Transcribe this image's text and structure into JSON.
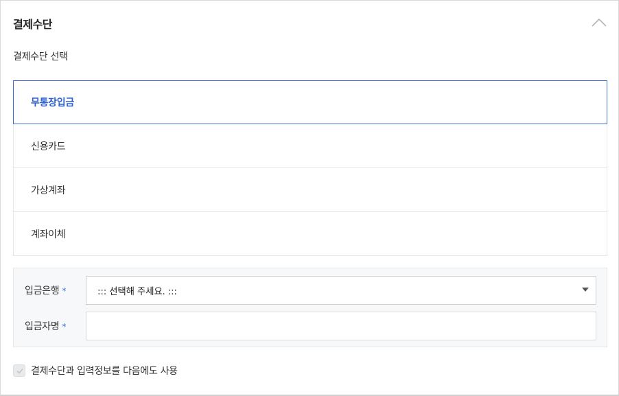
{
  "section": {
    "title": "결제수단",
    "collapse_icon": "chevron-up-icon",
    "subtitle": "결제수단 선택"
  },
  "payment_methods": [
    {
      "label": "무통장입금",
      "selected": true
    },
    {
      "label": "신용카드",
      "selected": false
    },
    {
      "label": "가상계좌",
      "selected": false
    },
    {
      "label": "계좌이체",
      "selected": false
    }
  ],
  "deposit_form": {
    "bank_label": "입금은행",
    "bank_select_value": "::: 선택해 주세요. :::",
    "name_label": "입금자명",
    "name_value": "",
    "required_mark": "*"
  },
  "remember_checkbox": {
    "label": "결제수단과 입력정보를 다음에도 사용",
    "checked": false
  },
  "colors": {
    "accent": "#3b6fd6",
    "selected_text": "#2e5fd1",
    "border": "#e6e6e6",
    "form_bg": "#f7f8fa"
  }
}
